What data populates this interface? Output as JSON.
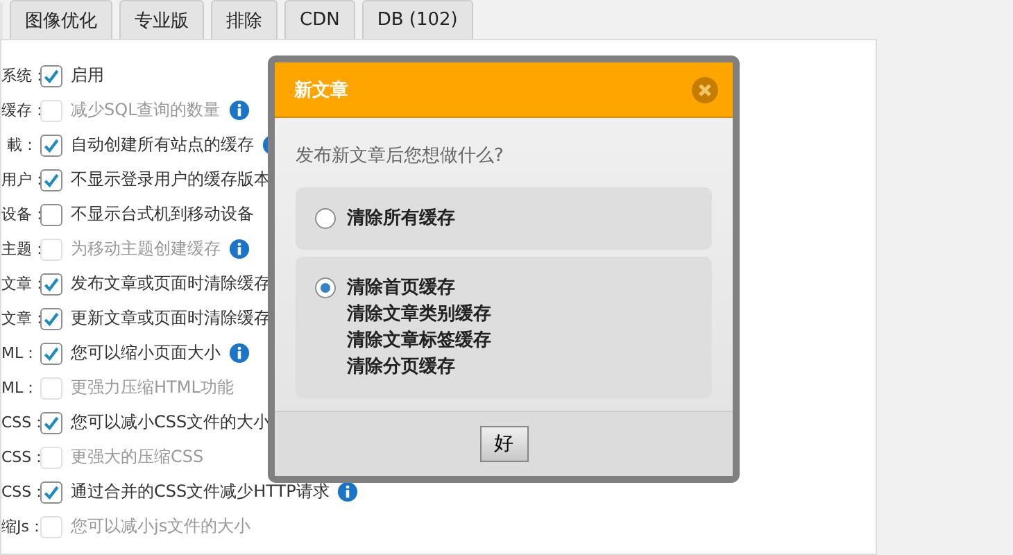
{
  "tabs": [
    {
      "label": "图像优化",
      "selected": false
    },
    {
      "label": "专业版",
      "selected": false
    },
    {
      "label": "排除",
      "selected": false
    },
    {
      "label": "CDN",
      "selected": false
    },
    {
      "label": "DB (102)",
      "selected": false
    }
  ],
  "settings": [
    {
      "label": "系统：",
      "text": "启用",
      "checked": true,
      "disabled": false,
      "info": false
    },
    {
      "label": "缓存：",
      "text": "减少SQL查询的数量",
      "checked": false,
      "disabled": true,
      "info": true
    },
    {
      "label": "載：",
      "text": "自动创建所有站点的缓存",
      "checked": true,
      "disabled": false,
      "info": true
    },
    {
      "label": "用户：",
      "text": "不显示登录用户的缓存版本",
      "checked": true,
      "disabled": false,
      "info": false
    },
    {
      "label": "设备：",
      "text": "不显示台式机到移动设备",
      "checked": false,
      "disabled": false,
      "info": false
    },
    {
      "label": "主题：",
      "text": "为移动主题创建缓存",
      "checked": false,
      "disabled": true,
      "info": true
    },
    {
      "label": "文章：",
      "text": "发布文章或页面时清除缓存",
      "checked": true,
      "disabled": false,
      "info": false
    },
    {
      "label": "文章：",
      "text": "更新文章或页面时清除缓存",
      "checked": true,
      "disabled": false,
      "info": false
    },
    {
      "label": "ML：",
      "text": "您可以缩小页面大小",
      "checked": true,
      "disabled": false,
      "info": true
    },
    {
      "label": "ML：",
      "text": "更强力压缩HTML功能",
      "checked": false,
      "disabled": true,
      "info": false
    },
    {
      "label": "CSS：",
      "text": "您可以减小CSS文件的大小",
      "checked": true,
      "disabled": false,
      "info": false
    },
    {
      "label": "CSS：",
      "text": "更强大的压缩CSS",
      "checked": false,
      "disabled": true,
      "info": false
    },
    {
      "label": "CSS：",
      "text": "通过合并的CSS文件减少HTTP请求",
      "checked": true,
      "disabled": false,
      "info": true
    },
    {
      "label": "缩Js：",
      "text": "您可以减小js文件的大小",
      "checked": false,
      "disabled": true,
      "info": false
    }
  ],
  "dialog": {
    "title": "新文章",
    "question": "发布新文章后您想做什么?",
    "options": [
      {
        "lines": [
          "清除所有缓存"
        ],
        "selected": false
      },
      {
        "lines": [
          "清除首页缓存",
          "清除文章类别缓存",
          "清除文章标签缓存",
          "清除分页缓存"
        ],
        "selected": true
      }
    ],
    "button": "好"
  }
}
